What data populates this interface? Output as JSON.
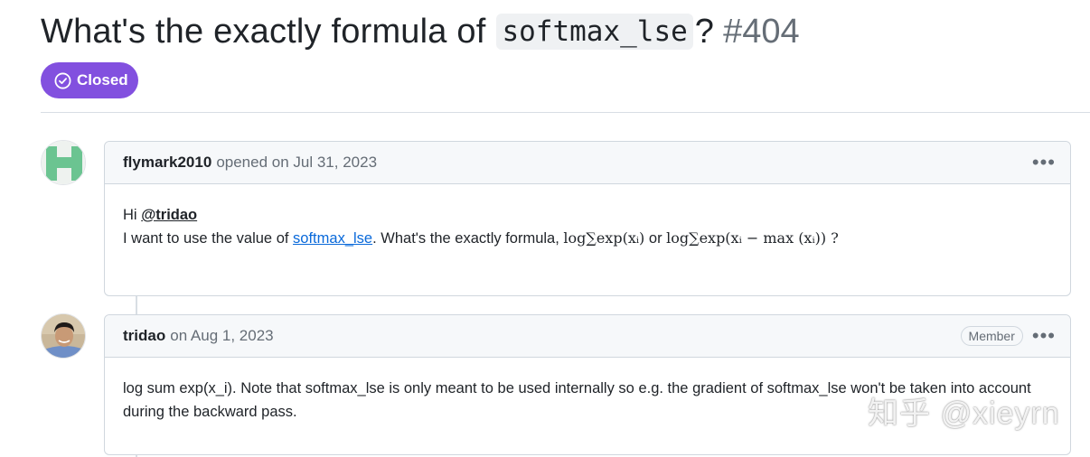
{
  "issue": {
    "title_prefix": "What's the exactly formula of",
    "title_code": "softmax_lse",
    "title_suffix": "?",
    "number": "#404",
    "state": "Closed"
  },
  "comments": [
    {
      "author": "flymark2010",
      "meta": "opened on Jul 31, 2023",
      "greeting": "Hi",
      "mention": "@tridao",
      "line2_before": "I want to use the value of",
      "link_text": "softmax_lse",
      "line2_after": ". What's the exactly formula,",
      "formula_1": "log∑exp(xᵢ)",
      "formula_or": "or",
      "formula_2": "log∑exp(xᵢ − max (xᵢ)) ?"
    },
    {
      "author": "tridao",
      "meta": "on Aug 1, 2023",
      "badge": "Member",
      "body": "log sum exp(x_i). Note that softmax_lse is only meant to be used internally so e.g. the gradient of softmax_lse won't be taken into account during the backward pass."
    }
  ],
  "actions_icon": "•••",
  "watermark": "知乎 @xieyrn",
  "colors": {
    "closed_badge": "#8250df",
    "link": "#0969da",
    "header_bg": "#f6f8fa",
    "border": "#d0d7de"
  }
}
